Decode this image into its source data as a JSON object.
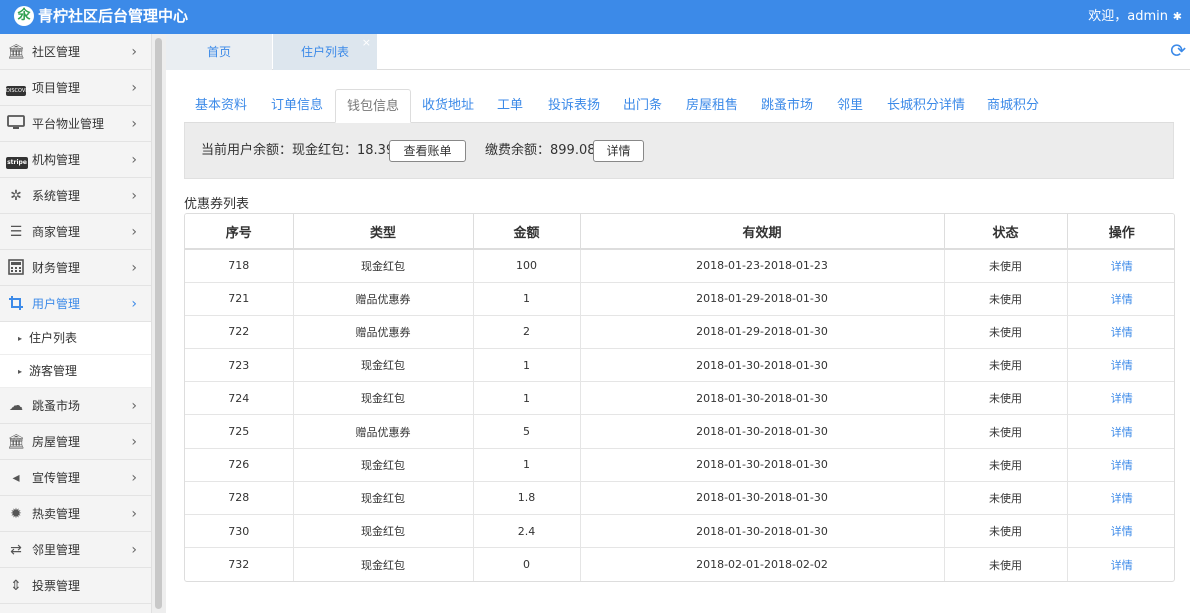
{
  "header": {
    "logo_glyph": "氽",
    "title": "青柠社区后台管理中心",
    "welcome": "欢迎，admin",
    "gear_glyph": "✱"
  },
  "sidebar": {
    "items": [
      {
        "label": "社区管理",
        "icon": "bank-icon",
        "glyph": "🏛"
      },
      {
        "label": "项目管理",
        "icon": "discover-card-icon",
        "glyph": "DISCOVER"
      },
      {
        "label": "平台物业管理",
        "icon": "monitor-icon",
        "glyph": "🖵"
      },
      {
        "label": "机构管理",
        "icon": "stripe-icon",
        "glyph": "stripe"
      },
      {
        "label": "系统管理",
        "icon": "yelp-icon",
        "glyph": "✲"
      },
      {
        "label": "商家管理",
        "icon": "menu-icon",
        "glyph": "☰"
      },
      {
        "label": "财务管理",
        "icon": "calculator-icon",
        "glyph": "▦"
      },
      {
        "label": "用户管理",
        "icon": "crop-icon",
        "glyph": "⌗"
      }
    ],
    "sub_items": [
      {
        "label": "住户列表"
      },
      {
        "label": "游客管理"
      }
    ],
    "items_after": [
      {
        "label": "跳蚤市场",
        "icon": "cloud-icon",
        "glyph": "☁"
      },
      {
        "label": "房屋管理",
        "icon": "bank-icon",
        "glyph": "🏛"
      },
      {
        "label": "宣传管理",
        "icon": "volume-icon",
        "glyph": "◂"
      },
      {
        "label": "热卖管理",
        "icon": "sun-icon",
        "glyph": "✹"
      },
      {
        "label": "邻里管理",
        "icon": "retweet-icon",
        "glyph": "⇄"
      },
      {
        "label": "投票管理",
        "icon": "sort-icon",
        "glyph": "⇕"
      }
    ],
    "chevron": "›",
    "sub_marker": "▸"
  },
  "page_tabs": {
    "home": "首页",
    "resident": "住户列表",
    "close": "×",
    "refresh_glyph": "⟳"
  },
  "sub_tabs": [
    "基本资料",
    "订单信息",
    "钱包信息",
    "收货地址",
    "工单",
    "投诉表扬",
    "出门条",
    "房屋租售",
    "跳蚤市场",
    "邻里",
    "长城积分详情",
    "商城积分"
  ],
  "balance": {
    "current_text": "当前用户余额：现金红包：18.39",
    "view_bill_button": "查看账单",
    "payment_text": "缴费余额：899.08",
    "detail_button": "详情"
  },
  "coupon_title": "优惠券列表",
  "table": {
    "headers": [
      "序号",
      "类型",
      "金额",
      "有效期",
      "状态",
      "操作"
    ],
    "rows": [
      [
        "718",
        "现金红包",
        "100",
        "2018-01-23-2018-01-23",
        "未使用",
        "详情"
      ],
      [
        "721",
        "赠品优惠券",
        "1",
        "2018-01-29-2018-01-30",
        "未使用",
        "详情"
      ],
      [
        "722",
        "赠品优惠券",
        "2",
        "2018-01-29-2018-01-30",
        "未使用",
        "详情"
      ],
      [
        "723",
        "现金红包",
        "1",
        "2018-01-30-2018-01-30",
        "未使用",
        "详情"
      ],
      [
        "724",
        "现金红包",
        "1",
        "2018-01-30-2018-01-30",
        "未使用",
        "详情"
      ],
      [
        "725",
        "赠品优惠券",
        "5",
        "2018-01-30-2018-01-30",
        "未使用",
        "详情"
      ],
      [
        "726",
        "现金红包",
        "1",
        "2018-01-30-2018-01-30",
        "未使用",
        "详情"
      ],
      [
        "728",
        "现金红包",
        "1.8",
        "2018-01-30-2018-01-30",
        "未使用",
        "详情"
      ],
      [
        "730",
        "现金红包",
        "2.4",
        "2018-01-30-2018-01-30",
        "未使用",
        "详情"
      ],
      [
        "732",
        "现金红包",
        "0",
        "2018-02-01-2018-02-02",
        "未使用",
        "详情"
      ]
    ]
  },
  "colors": {
    "brand": "#3c8ae8",
    "logo_green": "#2e9f4e"
  }
}
